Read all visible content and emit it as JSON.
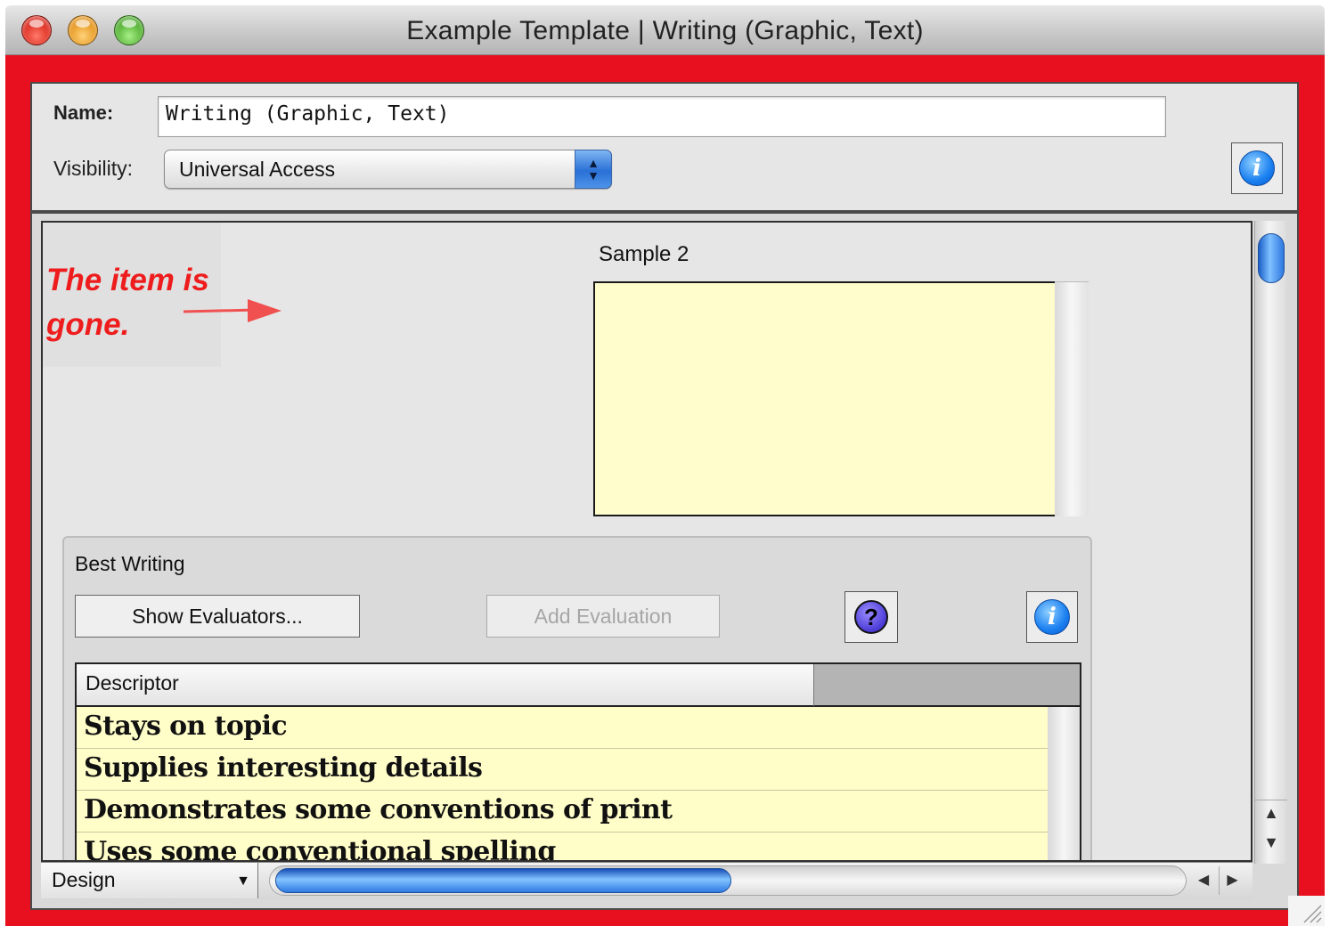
{
  "window": {
    "title": "Example Template | Writing  (Graphic, Text)",
    "frame_color": "#e8101e"
  },
  "header": {
    "name_label": "Name:",
    "name_value": "Writing (Graphic, Text)",
    "visibility_label": "Visibility:",
    "visibility_value": "Universal Access",
    "stepper_glyph": "▲▼",
    "info_glyph": "i"
  },
  "annotation": {
    "text": "The item is gone.",
    "color": "#ee1c1c"
  },
  "sample": {
    "label": "Sample 2",
    "fill_color": "#fffdcb"
  },
  "best_writing": {
    "title": "Best Writing",
    "show_evaluators_label": "Show Evaluators...",
    "add_evaluation_label": "Add Evaluation",
    "help_glyph": "?",
    "info_glyph": "i",
    "table": {
      "header": "Descriptor",
      "rows": [
        "Stays on topic",
        "Supplies interesting details",
        "Demonstrates some conventions of print",
        "Uses some conventional spelling"
      ]
    }
  },
  "bottom_bar": {
    "mode_value": "Design",
    "mode_arrow": "▼",
    "scroll_left": "◀",
    "scroll_right": "▶"
  },
  "vertical_scroll": {
    "up": "▲",
    "down": "▼"
  },
  "icons": {
    "close": "close-icon",
    "minimize": "minimize-icon",
    "zoom": "zoom-icon",
    "info": "info-icon",
    "help": "help-icon",
    "arrow": "arrow-icon",
    "resize": "resize-grip-icon"
  }
}
